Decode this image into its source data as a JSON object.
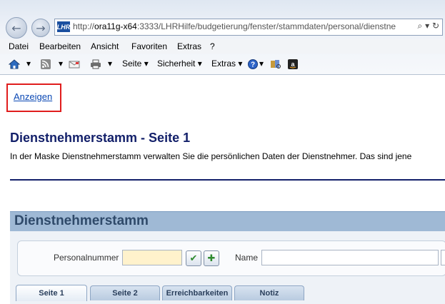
{
  "browser": {
    "url_prefix": "http://",
    "url_host": "ora11g-x64",
    "url_rest": ":3333/LHRHilfe/budgetierung/fenster/stammdaten/personal/dienstne",
    "favicon_text": "LHR"
  },
  "menu": [
    "Datei",
    "Bearbeiten",
    "Ansicht",
    "Favoriten",
    "Extras",
    "?"
  ],
  "toolbar": {
    "seite": "Seite",
    "sicherheit": "Sicherheit",
    "extras": "Extras"
  },
  "page": {
    "link": "Anzeigen",
    "title": "Dienstnehmerstamm - Seite 1",
    "intro": "In der Maske Dienstnehmerstamm verwalten Sie die persönlichen Daten der Dienstnehmer. Das sind jene"
  },
  "panel": {
    "title": "Dienstnehmerstamm",
    "personalnummer_label": "Personalnummer",
    "personalnummer_value": "",
    "name_label": "Name",
    "name_value": ""
  },
  "tabs": [
    "Seite 1",
    "Seite 2",
    "Erreichbarkeiten",
    "Notiz"
  ],
  "colors": {
    "highlight_box": "#e01d1d",
    "title": "#13206a",
    "link": "#0b48b4",
    "panel_header": "#9fb9d5",
    "required_field": "#fff2cc"
  }
}
